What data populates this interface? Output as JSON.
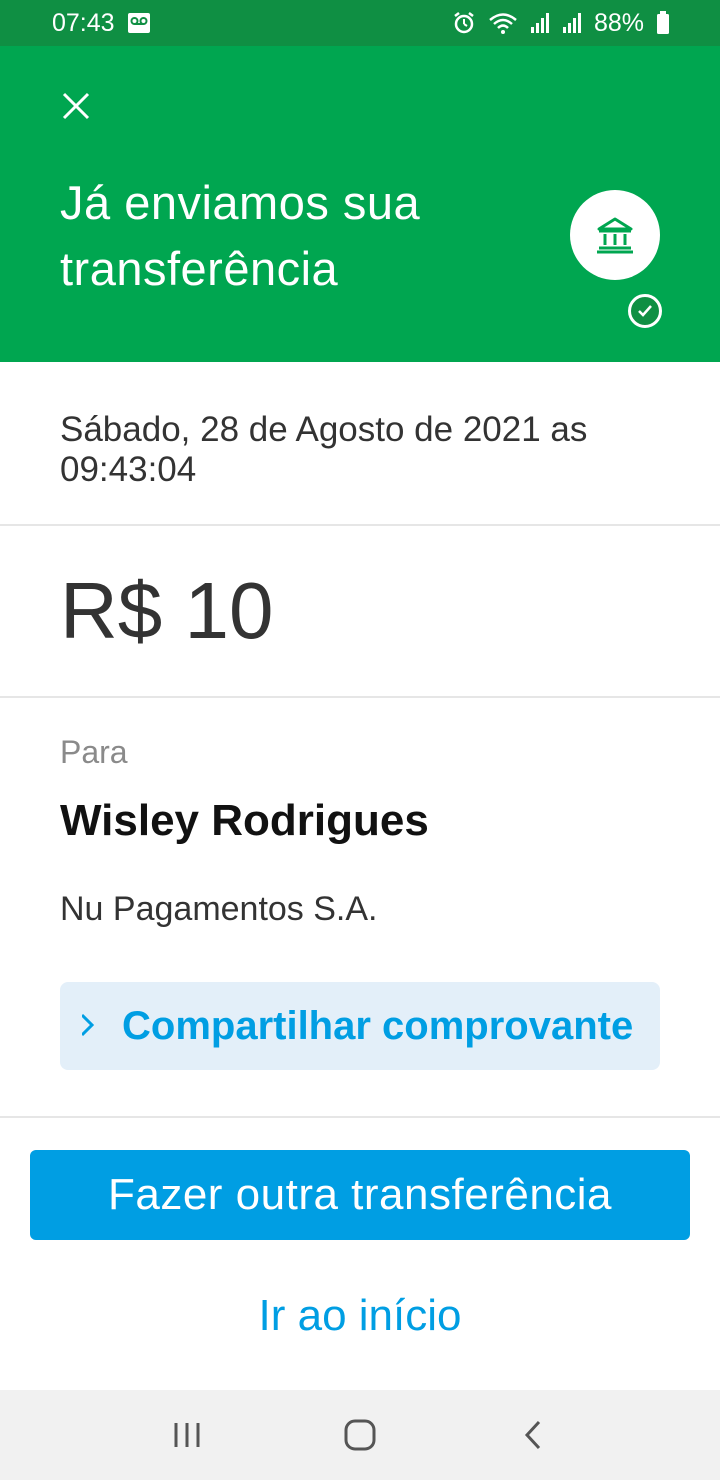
{
  "status_bar": {
    "time": "07:43",
    "battery": "88%",
    "icons": [
      "voicemail-icon",
      "alarm-icon",
      "wifi-icon",
      "signal-icon",
      "signal-icon",
      "battery-icon"
    ]
  },
  "header": {
    "title": "Já enviamos sua transferência",
    "close_icon": "close-icon",
    "badge_icon": "bank-icon",
    "check_icon": "check-icon"
  },
  "transfer": {
    "date": "Sábado, 28 de Agosto de 2021 as 09:43:04",
    "amount": "R$ 10"
  },
  "recipient": {
    "label": "Para",
    "name": "Wisley Rodrigues",
    "bank": "Nu Pagamentos S.A."
  },
  "actions": {
    "share_label": "Compartilhar comprovante",
    "share_icon": "share-icon",
    "primary_label": "Fazer outra transferência",
    "home_link": "Ir ao início"
  },
  "nav": {
    "icons": [
      "recent-apps-icon",
      "home-icon",
      "back-icon"
    ]
  },
  "colors": {
    "header_green": "#00a650",
    "status_green": "#0f8f43",
    "accent_blue": "#009ee3",
    "share_bg": "#e3eff9"
  }
}
